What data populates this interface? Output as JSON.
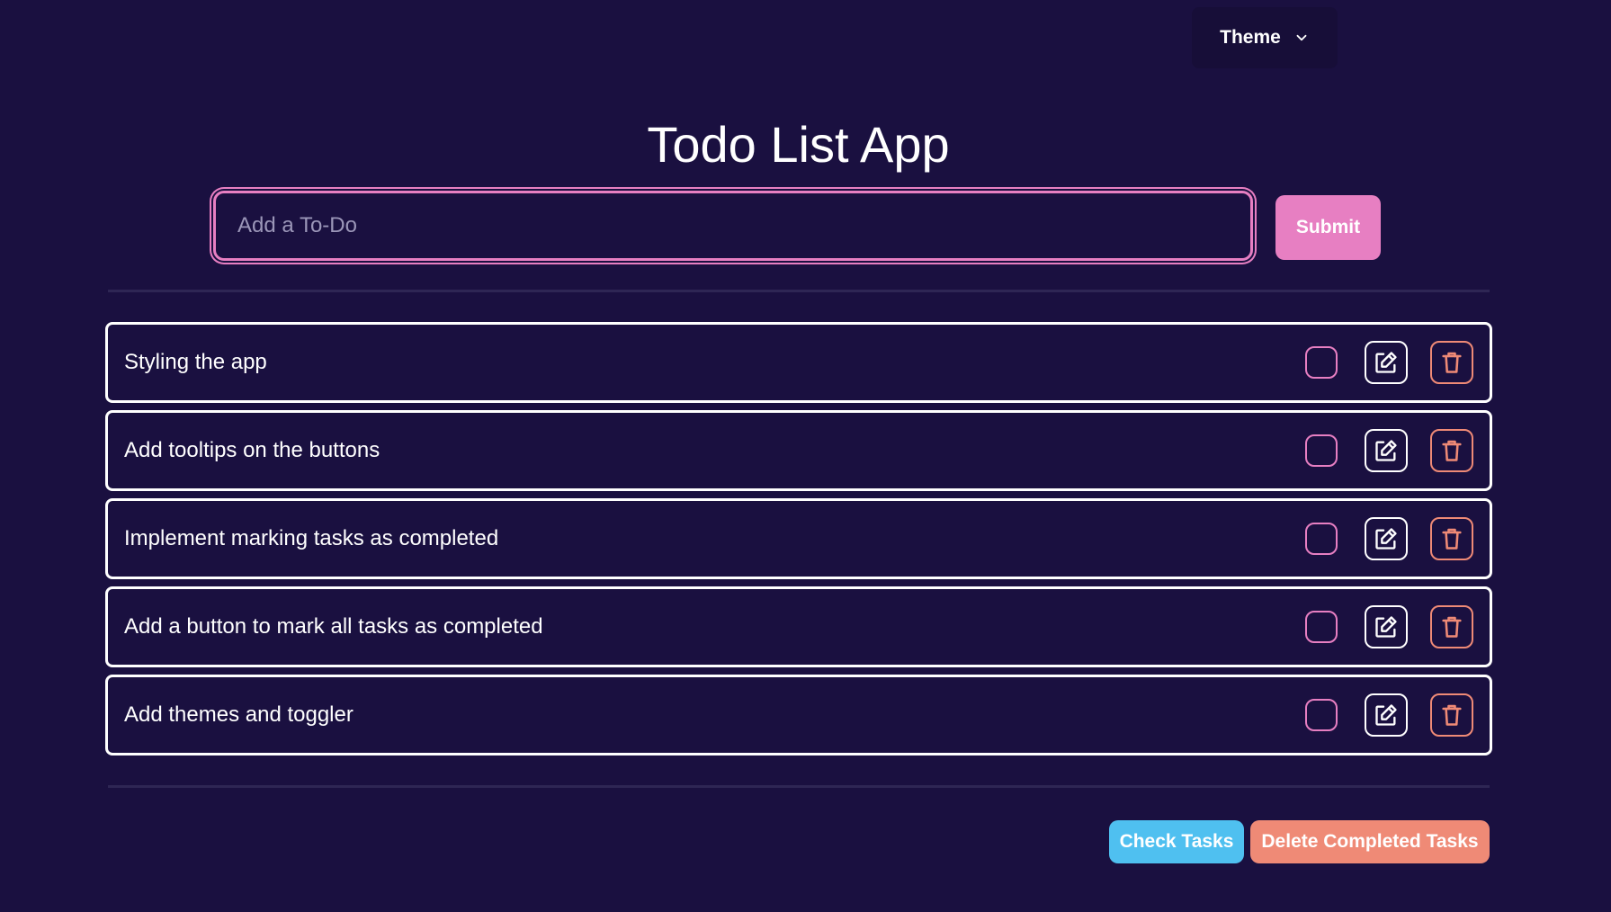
{
  "header": {
    "theme_label": "Theme"
  },
  "app": {
    "title": "Todo List App"
  },
  "input": {
    "placeholder": "Add a To-Do",
    "value": "",
    "submit_label": "Submit"
  },
  "todos": [
    {
      "text": "Styling the app",
      "completed": false
    },
    {
      "text": "Add tooltips on the buttons",
      "completed": false
    },
    {
      "text": "Implement marking tasks as completed",
      "completed": false
    },
    {
      "text": "Add a button to mark all tasks as completed",
      "completed": false
    },
    {
      "text": "Add themes and toggler",
      "completed": false
    }
  ],
  "footer": {
    "check_tasks_label": "Check Tasks",
    "delete_completed_label": "Delete Completed Tasks"
  },
  "colors": {
    "background": "#1a1040",
    "accent_pink": "#e77fc2",
    "accent_blue": "#4fc0f0",
    "accent_salmon": "#ef8a76",
    "border_white": "#ffffff",
    "divider": "#2e2654"
  },
  "icons": {
    "theme_dropdown": "chevron-down-icon",
    "edit": "pencil-square-icon",
    "delete": "trash-icon"
  }
}
